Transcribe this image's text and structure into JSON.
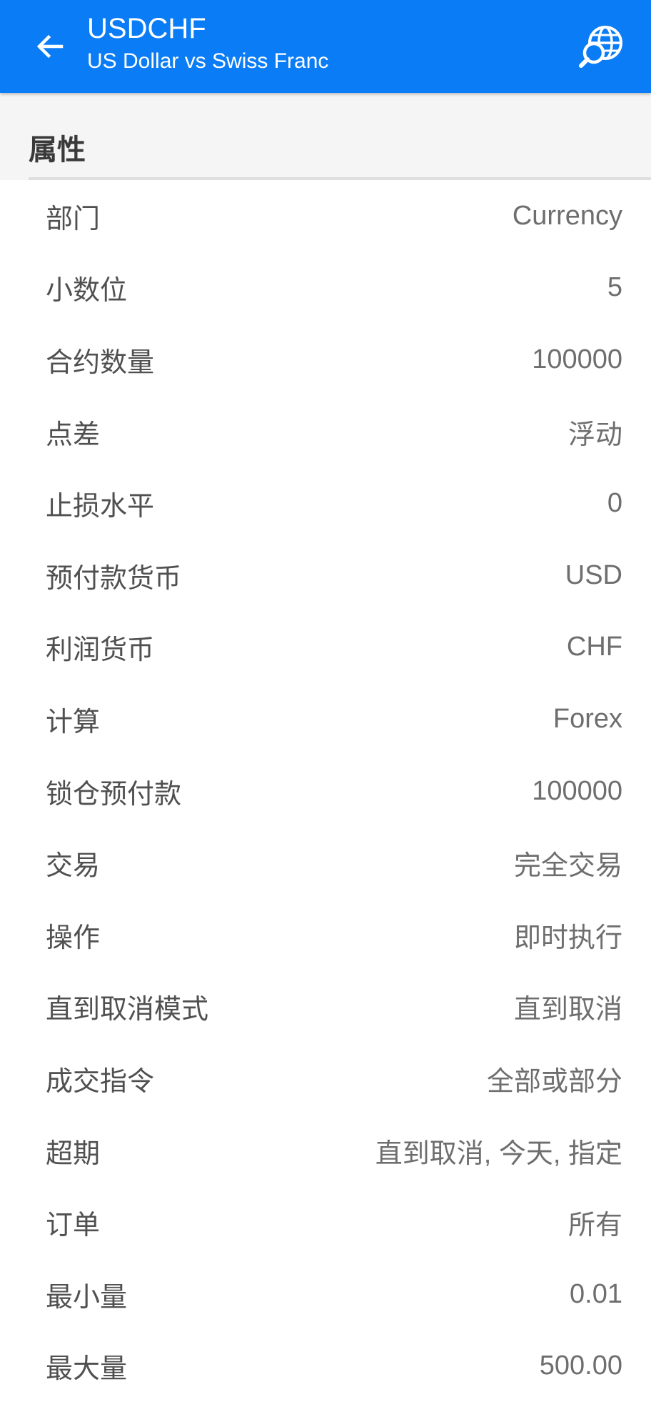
{
  "header": {
    "title": "USDCHF",
    "subtitle": "US Dollar vs Swiss Franc",
    "back_icon": "arrow-left-icon",
    "search_icon": "globe-search-icon",
    "background_color": "#0a7cf5"
  },
  "section": {
    "title": "属性"
  },
  "properties": [
    {
      "label": "部门",
      "value": "Currency"
    },
    {
      "label": "小数位",
      "value": "5"
    },
    {
      "label": "合约数量",
      "value": "100000"
    },
    {
      "label": "点差",
      "value": "浮动"
    },
    {
      "label": "止损水平",
      "value": "0"
    },
    {
      "label": "预付款货币",
      "value": "USD"
    },
    {
      "label": "利润货币",
      "value": "CHF"
    },
    {
      "label": "计算",
      "value": "Forex"
    },
    {
      "label": "锁仓预付款",
      "value": "100000"
    },
    {
      "label": "交易",
      "value": "完全交易"
    },
    {
      "label": "操作",
      "value": "即时执行"
    },
    {
      "label": "直到取消模式",
      "value": "直到取消"
    },
    {
      "label": "成交指令",
      "value": "全部或部分"
    },
    {
      "label": "超期",
      "value": "直到取消, 今天, 指定"
    },
    {
      "label": "订单",
      "value": "所有"
    },
    {
      "label": "最小量",
      "value": "0.01"
    },
    {
      "label": "最大量",
      "value": "500.00"
    }
  ]
}
